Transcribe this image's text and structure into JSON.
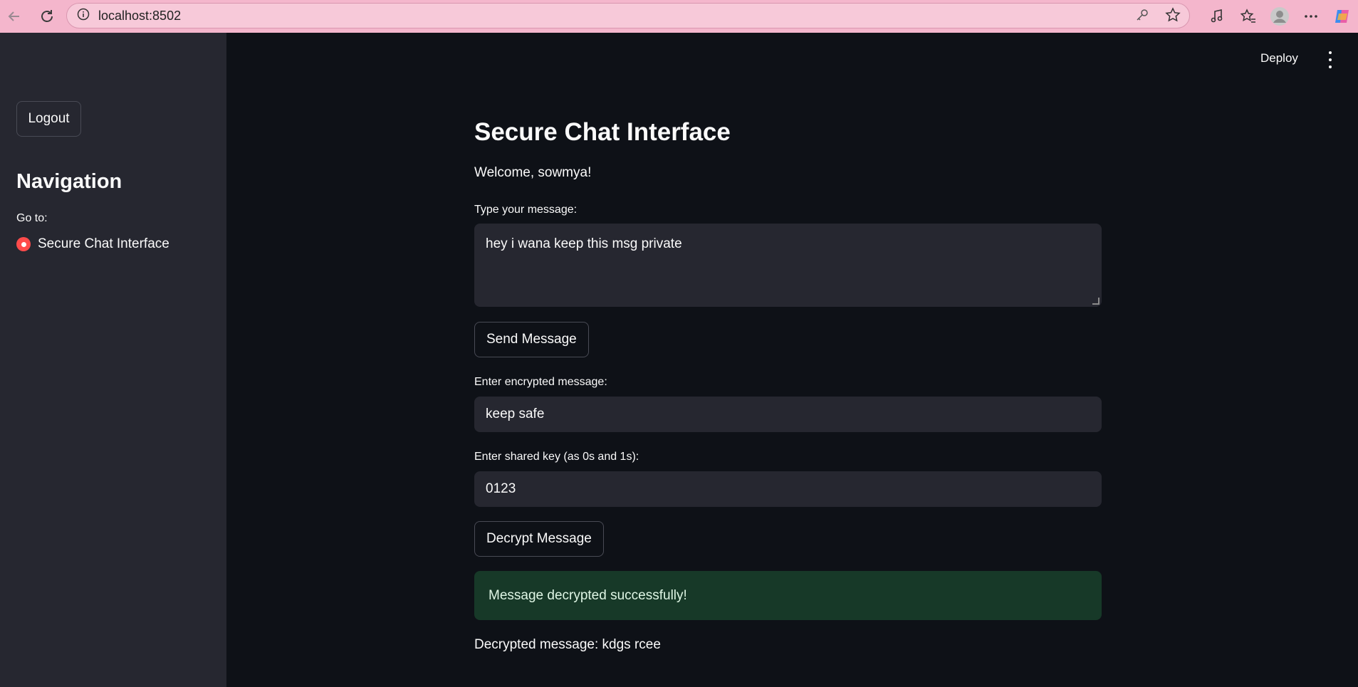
{
  "browser": {
    "url": "localhost:8502"
  },
  "sidebar": {
    "logout_label": "Logout",
    "nav_title": "Navigation",
    "goto_label": "Go to:",
    "nav_options": [
      "Secure Chat Interface"
    ],
    "selected_option": "Secure Chat Interface"
  },
  "header": {
    "deploy_label": "Deploy"
  },
  "main": {
    "title": "Secure Chat Interface",
    "welcome": "Welcome, sowmya!",
    "message_label": "Type your message:",
    "message_value": "hey i wana keep this msg private",
    "send_label": "Send Message",
    "encrypted_label": "Enter encrypted message:",
    "encrypted_value": "keep safe",
    "key_label": "Enter shared key (as 0s and 1s):",
    "key_value": "0123",
    "decrypt_label": "Decrypt Message",
    "success_text": "Message decrypted successfully!",
    "decrypted_text": "Decrypted message: kdgs rcee"
  },
  "colors": {
    "browser_bar": "#f4b6cc",
    "app_background": "#0e1117",
    "sidebar_background": "#262730",
    "input_background": "#262730",
    "radio_accent": "#ff4b4b",
    "success_background": "#173928"
  }
}
